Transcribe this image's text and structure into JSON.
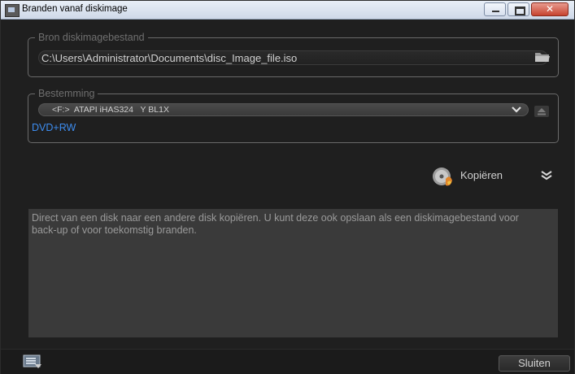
{
  "window": {
    "title": "Branden vanaf diskimage",
    "controls": {
      "minimize": "minimize",
      "maximize": "maximize",
      "close": "✕"
    }
  },
  "source": {
    "legend": "Bron diskimagebestand",
    "path": "C:\\Users\\Administrator\\Documents\\disc_Image_file.iso",
    "browse_icon": "folder-icon"
  },
  "destination": {
    "legend": "Bestemming",
    "drive": "<F:>  ATAPI iHAS324   Y BL1X",
    "media": "DVD+RW",
    "eject_icon": "eject-icon"
  },
  "action": {
    "label": "Kopiëren",
    "icon": "disc-copy-icon",
    "expand_icon": "double-chevron-down-icon"
  },
  "description": "Direct van een disk naar een andere disk kopiëren. U kunt deze ook opslaan als een diskimagebestand voor back-up of voor toekomstig branden.",
  "footer": {
    "close_label": "Sluiten",
    "log_icon": "log-list-icon"
  },
  "colors": {
    "background": "#1f1f1f",
    "media_text": "#3d8df0",
    "description_bg": "#3a3a3a"
  }
}
